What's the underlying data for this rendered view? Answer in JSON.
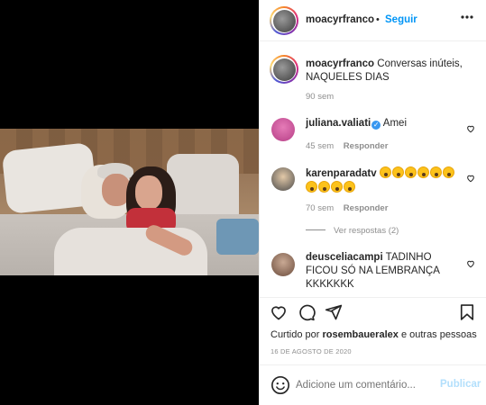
{
  "post": {
    "author": "moacyrfranco",
    "separator": "•",
    "follow_label": "Seguir",
    "caption": "Conversas inúteis, NAQUELES DIAS",
    "caption_age": "90 sem"
  },
  "comments": [
    {
      "username": "juliana.valiati",
      "verified": true,
      "text": "Amei",
      "age": "45 sem",
      "reply_label": "Responder"
    },
    {
      "username": "karenparadatv",
      "emoji_count_line1": 6,
      "emoji_count_line2": 4,
      "emoji_name": "face-screaming-in-fear",
      "age": "70 sem",
      "reply_label": "Responder",
      "view_replies": "Ver respostas (2)"
    },
    {
      "username": "deusceliacampi",
      "text": "TADINHO FICOU SÓ NA LEMBRANÇA KKKKKKK"
    }
  ],
  "likes": {
    "prefix": "Curtido por",
    "user": "rosembaueralex",
    "suffix": "e outras pessoas"
  },
  "date": "16 DE AGOSTO DE 2020",
  "comment_box": {
    "placeholder": "Adicione um comentário...",
    "publish_label": "Publicar"
  },
  "icons": {
    "more": "more-horizontal-icon",
    "like": "heart-icon",
    "comment": "comment-icon",
    "share": "paper-plane-icon",
    "save": "bookmark-icon",
    "emoji": "smiley-icon"
  },
  "colors": {
    "accent": "#0095f6",
    "muted": "#8e8e8e",
    "text": "#262626",
    "publish_disabled": "#b2dffc"
  }
}
